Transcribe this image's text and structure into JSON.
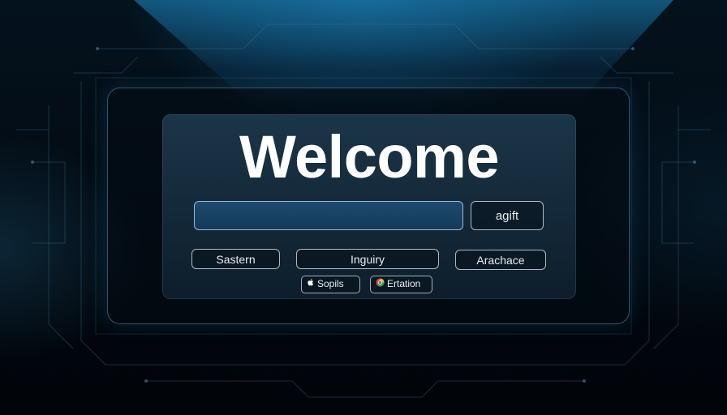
{
  "welcome": {
    "title": "Welcome"
  },
  "search": {
    "value": "",
    "placeholder": ""
  },
  "actions": {
    "submit_label": "agift",
    "secondary": [
      "Sastern",
      "Inguiry",
      "Arachace"
    ]
  },
  "social": {
    "apple_label": "Sopils",
    "browser_label": "Ertation"
  },
  "colors": {
    "accent": "#1e6fa0",
    "input_fill": "#1e4a6e",
    "text": "#ffffff"
  },
  "icons": [
    "apple-icon",
    "browser-icon"
  ]
}
